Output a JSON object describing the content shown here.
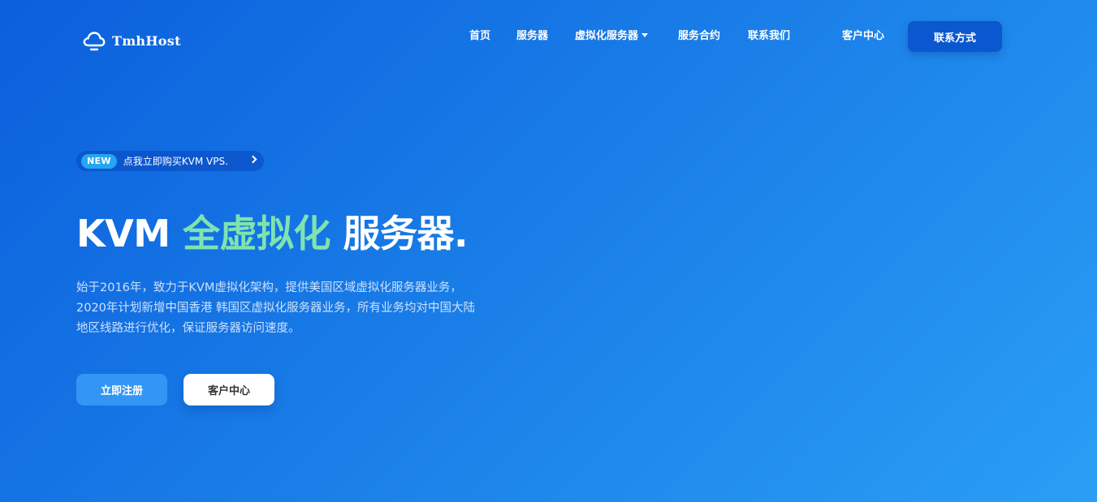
{
  "header": {
    "logo_text": "TmhHost",
    "nav": [
      {
        "label": "首页"
      },
      {
        "label": "服务器"
      },
      {
        "label": "虚拟化服务器"
      },
      {
        "label": "服务合约"
      },
      {
        "label": "联系我们"
      },
      {
        "label": "客户中心"
      }
    ],
    "contact_button": "联系方式"
  },
  "hero": {
    "promo_badge": "NEW",
    "promo_text": "点我立即购买KVM VPS.",
    "headline_part1": "KVM ",
    "headline_accent": "全虚拟化",
    "headline_part2": " 服务器.",
    "description": [
      "始于2016年，致力于KVM虚拟化架构，提供美国区域虚拟化服务器业务，",
      "2020年计划新增中国香港 韩国区虚拟化服务器业务，所有业务均对中国大陆",
      "地区线路进行优化，保证服务器访问速度。"
    ],
    "primary_button": "立即注册",
    "secondary_button": "客户中心"
  },
  "colors": {
    "background_start": "#0b5fdc",
    "background_end": "#2a9ef5",
    "accent_green": "#7fe3b0",
    "badge_blue": "#24a6f2",
    "button_dark": "#0b57d0",
    "button_light": "#3396f5"
  },
  "icons": {
    "logo": "cloud-icon",
    "dropdown": "caret-down-icon",
    "promo_arrow": "chevron-right-icon"
  }
}
